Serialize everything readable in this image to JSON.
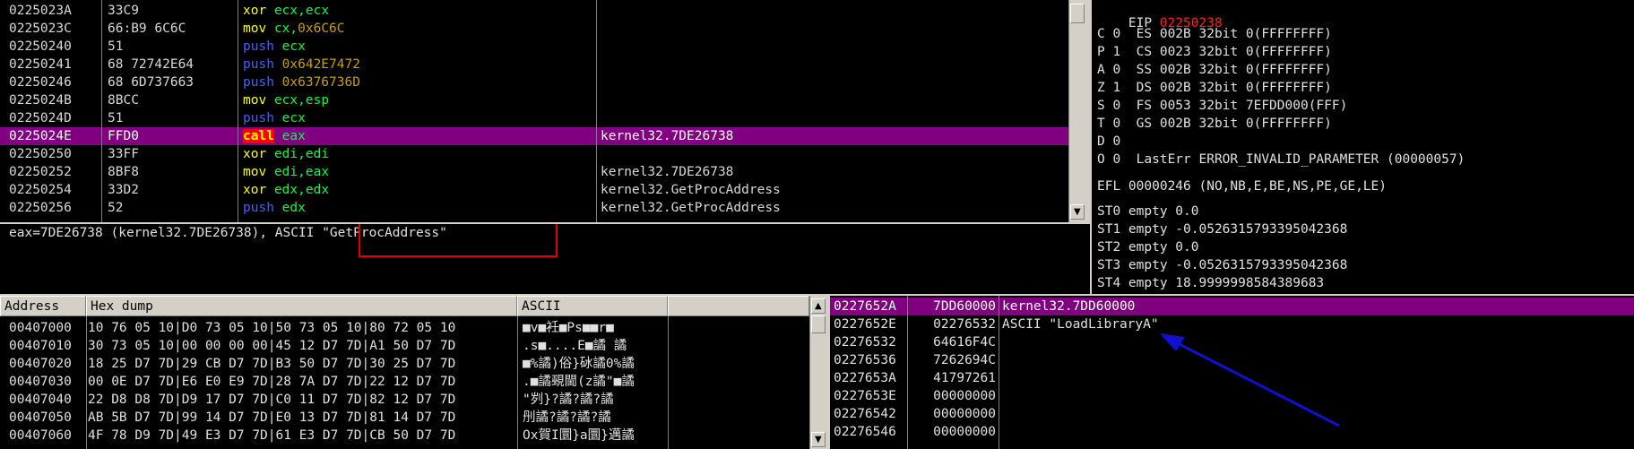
{
  "cpu": {
    "rows": [
      {
        "addr": "0225023A",
        "hex": "33C9",
        "mn": "xor",
        "ops": "ecx,ecx",
        "imm": "",
        "comment": "",
        "sel": false
      },
      {
        "addr": "0225023C",
        "hex": "66:B9 6C6C",
        "mn": "mov",
        "ops": "cx,",
        "imm": "0x6C6C",
        "comment": "",
        "sel": false
      },
      {
        "addr": "02250240",
        "hex": "51",
        "mn": "push",
        "ops": "ecx",
        "imm": "",
        "comment": "",
        "sel": false
      },
      {
        "addr": "02250241",
        "hex": "68 72742E64",
        "mn": "push",
        "ops": "",
        "imm": "0x642E7472",
        "comment": "",
        "sel": false
      },
      {
        "addr": "02250246",
        "hex": "68 6D737663",
        "mn": "push",
        "ops": "",
        "imm": "0x6376736D",
        "comment": "",
        "sel": false
      },
      {
        "addr": "0225024B",
        "hex": "8BCC",
        "mn": "mov",
        "ops": "ecx,esp",
        "imm": "",
        "comment": "",
        "sel": false
      },
      {
        "addr": "0225024D",
        "hex": "51",
        "mn": "push",
        "ops": "ecx",
        "imm": "",
        "comment": "",
        "sel": false
      },
      {
        "addr": "0225024E",
        "hex": "FFD0",
        "mn": "call",
        "ops": "eax",
        "imm": "",
        "comment": "kernel32.7DE26738",
        "sel": true
      },
      {
        "addr": "02250250",
        "hex": "33FF",
        "mn": "xor",
        "ops": "edi,edi",
        "imm": "",
        "comment": "",
        "sel": false
      },
      {
        "addr": "02250252",
        "hex": "8BF8",
        "mn": "mov",
        "ops": "edi,eax",
        "imm": "",
        "comment": "kernel32.7DE26738",
        "sel": false
      },
      {
        "addr": "02250254",
        "hex": "33D2",
        "mn": "xor",
        "ops": "edx,edx",
        "imm": "",
        "comment": "kernel32.GetProcAddress",
        "sel": false
      },
      {
        "addr": "02250256",
        "hex": "52",
        "mn": "push",
        "ops": "edx",
        "imm": "",
        "comment": "kernel32.GetProcAddress",
        "sel": false
      }
    ]
  },
  "info": {
    "text": "eax=7DE26738 (kernel32.7DE26738), ASCII \"GetProcAddress\""
  },
  "registers": {
    "eip_label": "EIP",
    "eip_value": "02250238",
    "flags": [
      "C 0  ES 002B 32bit 0(FFFFFFFF)",
      "P 1  CS 0023 32bit 0(FFFFFFFF)",
      "A 0  SS 002B 32bit 0(FFFFFFFF)",
      "Z 1  DS 002B 32bit 0(FFFFFFFF)",
      "S 0  FS 0053 32bit 7EFDD000(FFF)",
      "T 0  GS 002B 32bit 0(FFFFFFFF)",
      "D 0",
      "O 0  LastErr ERROR_INVALID_PARAMETER (00000057)"
    ],
    "efl": "EFL 00000246 (NO,NB,E,BE,NS,PE,GE,LE)",
    "fpu": [
      "ST0 empty 0.0",
      "ST1 empty -0.0526315793395042368",
      "ST2 empty 0.0",
      "ST3 empty -0.0526315793395042368",
      "ST4 empty 18.9999998584389683"
    ]
  },
  "dump": {
    "headers": {
      "address": "Address",
      "hex": "Hex dump",
      "ascii": "ASCII"
    },
    "rows": [
      {
        "addr": "00407000",
        "hex": "10 76 05 10|D0 73 05 10|50 73 05 10|80 72 05 10",
        "ascii": "■v■衽■Ps■■r■"
      },
      {
        "addr": "00407010",
        "hex": "30 73 05 10|00 00 00 00|45 12 D7 7D|A1 50 D7 7D",
        "ascii": ".s■....E■譎 譎"
      },
      {
        "addr": "00407020",
        "hex": "18 25 D7 7D|29 CB D7 7D|B3 50 D7 7D|30 25 D7 7D",
        "ascii": "■%譎)俗}砅譎0%譎"
      },
      {
        "addr": "00407030",
        "hex": "00 0E D7 7D|E6 E0 E9 7D|28 7A D7 7D|22 12 D7 7D",
        "ascii": ".■譎覡閫(z譎\"■譎"
      },
      {
        "addr": "00407040",
        "hex": "22 D8 D8 7D|D9 17 D7 7D|C0 11 D7 7D|82 12 D7 7D",
        "ascii": "\"刿}?譎?譎?譎"
      },
      {
        "addr": "00407050",
        "hex": "AB 5B D7 7D|99 14 D7 7D|E0 13 D7 7D|81 14 D7 7D",
        "ascii": "刐譎?譎?譎?譎"
      },
      {
        "addr": "00407060",
        "hex": "4F 78 D9 7D|49 E3 D7 7D|61 E3 D7 7D|CB 50 D7 7D",
        "ascii": "Ox賀I圜}a圜}邁譎"
      }
    ]
  },
  "stack": {
    "rows": [
      {
        "addr": "0227652A",
        "val": "7DD60000",
        "comment": "kernel32.7DD60000",
        "sel": true
      },
      {
        "addr": "0227652E",
        "val": "02276532",
        "comment": "ASCII \"LoadLibraryA\"",
        "sel": false
      },
      {
        "addr": "02276532",
        "val": "64616F4C",
        "comment": "",
        "sel": false
      },
      {
        "addr": "02276536",
        "val": "7262694C",
        "comment": "",
        "sel": false
      },
      {
        "addr": "0227653A",
        "val": "41797261",
        "comment": "",
        "sel": false
      },
      {
        "addr": "0227653E",
        "val": "00000000",
        "comment": "",
        "sel": false
      },
      {
        "addr": "02276542",
        "val": "00000000",
        "comment": "",
        "sel": false
      },
      {
        "addr": "02276546",
        "val": "00000000",
        "comment": "",
        "sel": false
      }
    ]
  },
  "colors": {
    "selection": "#800080",
    "highlight_box": "#e00000",
    "arrow": "#1010d0",
    "eip": "#ff2020"
  }
}
